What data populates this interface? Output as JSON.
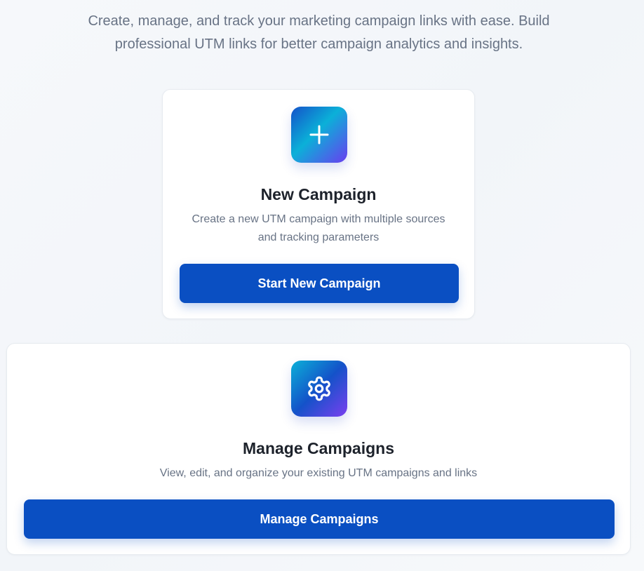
{
  "intro": {
    "text": "Create, manage, and track your marketing campaign links with ease. Build professional UTM links for better campaign analytics and insights."
  },
  "new_campaign": {
    "icon": "plus-icon",
    "title": "New Campaign",
    "description": "Create a new UTM campaign with multiple sources and tracking parameters",
    "button_label": "Start New Campaign"
  },
  "manage_campaigns": {
    "icon": "gear-icon",
    "title": "Manage Campaigns",
    "description": "View, edit, and organize your existing UTM campaigns and links",
    "button_label": "Manage Campaigns"
  },
  "colors": {
    "primary_button": "#0a4fc2",
    "muted_text": "#687385",
    "heading_text": "#1d222b"
  }
}
